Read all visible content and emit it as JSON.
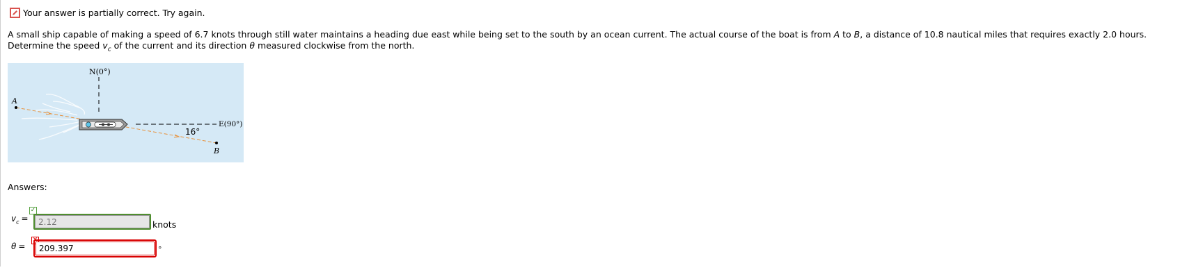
{
  "status": {
    "icon": "pencil-edit-icon",
    "text": "Your answer is partially correct.  Try again.",
    "color": "#d9534f"
  },
  "problem": {
    "text_1": "A small ship capable of making a speed of 6.7 knots through still water maintains a heading due east while being set to the south by an ocean current. The actual course of the boat is from ",
    "point_a": "A",
    "text_2": " to ",
    "point_b": "B",
    "text_3": ", a distance of 10.8 nautical miles that requires exactly 2.0 hours. Determine the speed ",
    "var_v": "v",
    "var_v_sub": "c",
    "text_4": " of the current and its direction ",
    "var_theta": "θ",
    "text_5": " measured clockwise from the north."
  },
  "figure": {
    "label_north": "N(0°)",
    "label_east": "E(90°)",
    "label_a": "A",
    "label_b": "B",
    "angle_label": "16°",
    "background": "#d5e9f6"
  },
  "answers": {
    "heading": "Answers:",
    "vc": {
      "var": "v",
      "sub": "c",
      "eq": "=",
      "value": "2.12",
      "unit": "knots",
      "status": "correct"
    },
    "theta": {
      "var": "θ",
      "eq": "=",
      "value": "209.397",
      "unit": "°",
      "status": "incorrect"
    }
  },
  "colors": {
    "correct": "#4f8d2f",
    "incorrect": "#d80000"
  }
}
